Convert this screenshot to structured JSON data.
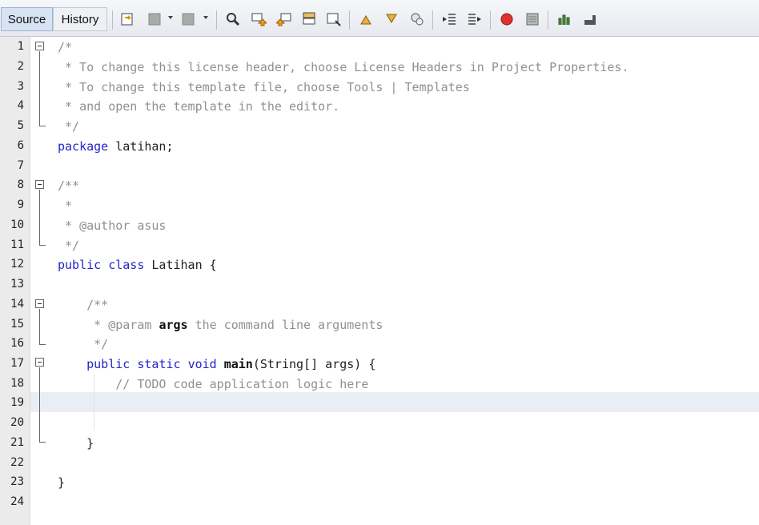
{
  "tabs": {
    "source": "Source",
    "history": "History"
  },
  "toolbar_icons": [
    "last-edit-icon",
    "back-icon",
    "forward-icon",
    "find-icon",
    "find-previous-icon",
    "find-next-icon",
    "find-selection-icon",
    "toggle-highlight-icon",
    "previous-bookmark-icon",
    "next-bookmark-icon",
    "toggle-bookmark-icon",
    "shift-left-icon",
    "shift-right-icon",
    "start-macro-icon",
    "stop-macro-icon",
    "comment-icon",
    "uncomment-icon"
  ],
  "line_numbers": [
    "1",
    "2",
    "3",
    "4",
    "5",
    "6",
    "7",
    "8",
    "9",
    "10",
    "11",
    "12",
    "13",
    "14",
    "15",
    "16",
    "17",
    "18",
    "19",
    "20",
    "21",
    "22",
    "23",
    "24"
  ],
  "code": {
    "l1": "/*",
    "l2": " * To change this license header, choose License Headers in Project Properties.",
    "l3": " * To change this template file, choose Tools | Templates",
    "l4": " * and open the template in the editor.",
    "l5": " */",
    "l6_kw": "package",
    "l6_rest": " latihan;",
    "l8": "/**",
    "l9": " *",
    "l10_star": " * ",
    "l10_ann": "@author",
    "l10_rest": " asus",
    "l11": " */",
    "l12_kw1": "public",
    "l12_kw2": "class",
    "l12_rest": " Latihan {",
    "l14": "    /**",
    "l15_star": "     * ",
    "l15_ann": "@param",
    "l15_bold": "args",
    "l15_rest": " the command line arguments",
    "l16": "     */",
    "l17_kw1": "public",
    "l17_kw2": "static",
    "l17_kw3": "void",
    "l17_name": "main",
    "l17_rest": "(String[] args) {",
    "l18": "        // TODO code application logic here",
    "l21": "    }",
    "l23": "}"
  },
  "colors": {
    "keyword": "#2424c8",
    "comment": "#909090",
    "highlight_line": "#e9eef5",
    "gutter": "#ebebeb"
  }
}
